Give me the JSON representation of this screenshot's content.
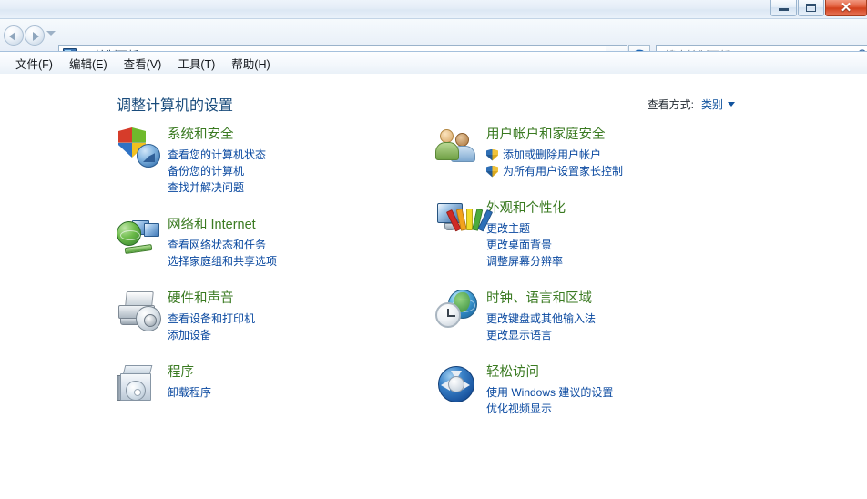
{
  "window": {
    "buttons": {
      "minimize": "Minimize",
      "maximize": "Maximize",
      "close": "✕"
    }
  },
  "navbar": {
    "back": "后退",
    "forward": "前进",
    "recent_pages": "最近访问的页面",
    "address": {
      "icon": "control-panel-icon",
      "separator": "▸",
      "crumbs": [
        "控制面板"
      ],
      "dropdown": "▾",
      "refresh": "↻"
    },
    "search": {
      "placeholder": "搜索控制面板",
      "icon": "search-icon"
    }
  },
  "menubar": {
    "items": [
      {
        "label": "文件(F)"
      },
      {
        "label": "编辑(E)"
      },
      {
        "label": "查看(V)"
      },
      {
        "label": "工具(T)"
      },
      {
        "label": "帮助(H)"
      }
    ]
  },
  "content": {
    "page_title": "调整计算机的设置",
    "view_by": {
      "label": "查看方式:",
      "value": "类别"
    },
    "columns": {
      "left": [
        {
          "icon": "security-shield-icon",
          "title": "系统和安全",
          "links": [
            {
              "text": "查看您的计算机状态",
              "shield": false
            },
            {
              "text": "备份您的计算机",
              "shield": false
            },
            {
              "text": "查找并解决问题",
              "shield": false
            }
          ]
        },
        {
          "icon": "network-icon",
          "title": "网络和 Internet",
          "links": [
            {
              "text": "查看网络状态和任务",
              "shield": false
            },
            {
              "text": "选择家庭组和共享选项",
              "shield": false
            }
          ]
        },
        {
          "icon": "hardware-sound-icon",
          "title": "硬件和声音",
          "links": [
            {
              "text": "查看设备和打印机",
              "shield": false
            },
            {
              "text": "添加设备",
              "shield": false
            }
          ]
        },
        {
          "icon": "programs-icon",
          "title": "程序",
          "links": [
            {
              "text": "卸载程序",
              "shield": false
            }
          ]
        }
      ],
      "right": [
        {
          "icon": "user-accounts-icon",
          "title": "用户帐户和家庭安全",
          "links": [
            {
              "text": "添加或删除用户帐户",
              "shield": true
            },
            {
              "text": "为所有用户设置家长控制",
              "shield": true
            }
          ]
        },
        {
          "icon": "appearance-icon",
          "title": "外观和个性化",
          "links": [
            {
              "text": "更改主题",
              "shield": false
            },
            {
              "text": "更改桌面背景",
              "shield": false
            },
            {
              "text": "调整屏幕分辨率",
              "shield": false
            }
          ]
        },
        {
          "icon": "clock-language-icon",
          "title": "时钟、语言和区域",
          "links": [
            {
              "text": "更改键盘或其他输入法",
              "shield": false
            },
            {
              "text": "更改显示语言",
              "shield": false
            }
          ]
        },
        {
          "icon": "ease-of-access-icon",
          "title": "轻松访问",
          "links": [
            {
              "text": "使用 Windows 建议的设置",
              "shield": false
            },
            {
              "text": "优化视频显示",
              "shield": false
            }
          ]
        }
      ]
    }
  },
  "colors": {
    "category_title": "#3a7a21",
    "link": "#0a49a0",
    "page_title": "#1a4c7c",
    "close_button": "#d2401c"
  }
}
